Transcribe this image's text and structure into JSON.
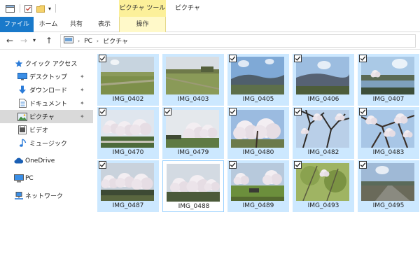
{
  "titlebar": {
    "context_tab": "ピクチャ ツール",
    "window_title": "ピクチャ"
  },
  "ribbon": {
    "tabs": [
      "ファイル",
      "ホーム",
      "共有",
      "表示",
      "操作"
    ]
  },
  "address": {
    "crumbs": [
      "PC",
      "ピクチャ"
    ]
  },
  "nav": {
    "items": [
      {
        "label": "クイック アクセス",
        "icon": "star-icon",
        "pinned": false
      },
      {
        "label": "デスクトップ",
        "icon": "desktop-icon",
        "pinned": true
      },
      {
        "label": "ダウンロード",
        "icon": "download-icon",
        "pinned": true
      },
      {
        "label": "ドキュメント",
        "icon": "documents-icon",
        "pinned": true
      },
      {
        "label": "ピクチャ",
        "icon": "pictures-icon",
        "pinned": true,
        "selected": true
      },
      {
        "label": "ビデオ",
        "icon": "video-icon",
        "pinned": false
      },
      {
        "label": "ミュージック",
        "icon": "music-icon",
        "pinned": false
      },
      {
        "label": "OneDrive",
        "icon": "onedrive-icon",
        "pinned": false
      },
      {
        "label": "PC",
        "icon": "pc-icon",
        "pinned": false
      },
      {
        "label": "ネットワーク",
        "icon": "network-icon",
        "pinned": false
      }
    ]
  },
  "files": [
    {
      "name": "IMG_0402",
      "checked": true,
      "scene": "field"
    },
    {
      "name": "IMG_0403",
      "checked": false,
      "scene": "field2"
    },
    {
      "name": "IMG_0405",
      "checked": true,
      "scene": "hills"
    },
    {
      "name": "IMG_0406",
      "checked": true,
      "scene": "hills2"
    },
    {
      "name": "IMG_0407",
      "checked": true,
      "scene": "lake"
    },
    {
      "name": "IMG_0470",
      "checked": true,
      "scene": "blossom"
    },
    {
      "name": "IMG_0479",
      "checked": true,
      "scene": "blossom2"
    },
    {
      "name": "IMG_0480",
      "checked": true,
      "scene": "blossom3"
    },
    {
      "name": "IMG_0482",
      "checked": true,
      "scene": "branches"
    },
    {
      "name": "IMG_0483",
      "checked": true,
      "scene": "branches2"
    },
    {
      "name": "IMG_0487",
      "checked": true,
      "scene": "blossom4"
    },
    {
      "name": "IMG_0488",
      "checked": false,
      "scene": "blossom5",
      "focused": true
    },
    {
      "name": "IMG_0489",
      "checked": true,
      "scene": "park"
    },
    {
      "name": "IMG_0493",
      "checked": true,
      "scene": "foliage"
    },
    {
      "name": "IMG_0495",
      "checked": true,
      "scene": "road"
    }
  ],
  "colors": {
    "file_tab": "#1979ca",
    "context_band": "#fcf09a",
    "selection": "#cce8ff",
    "nav_selected": "#d9d9d9"
  }
}
